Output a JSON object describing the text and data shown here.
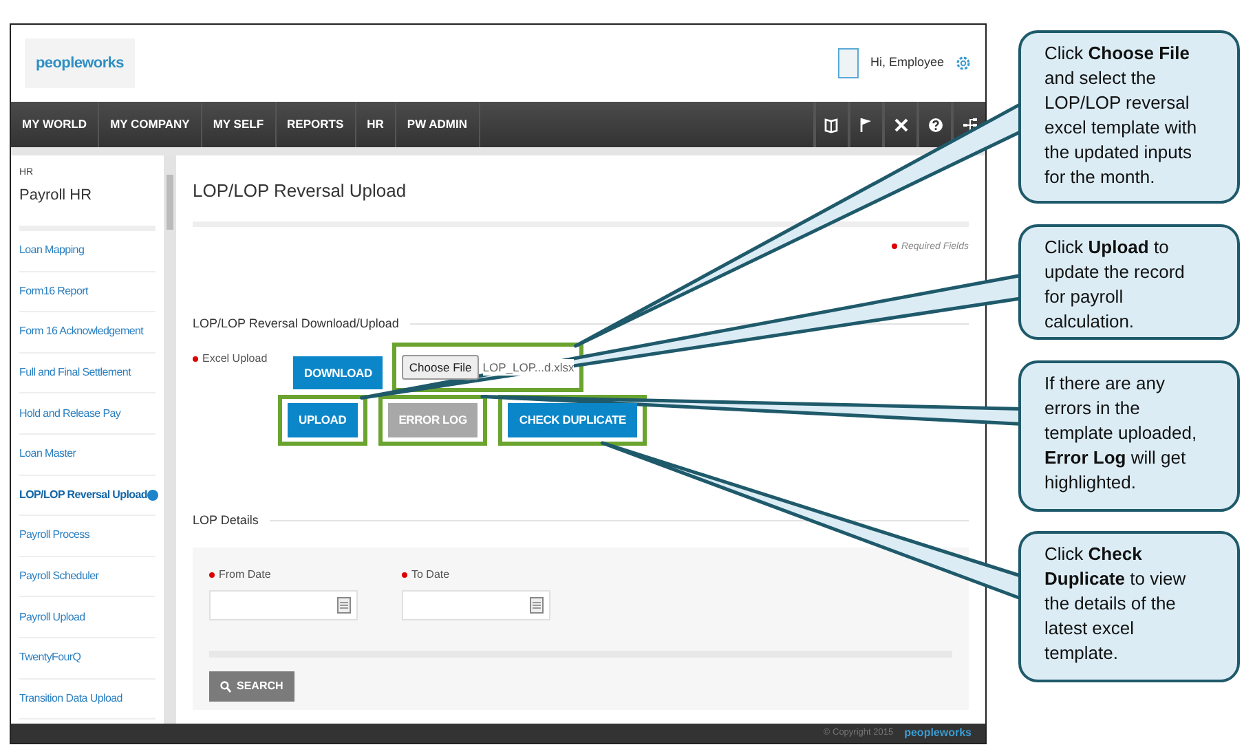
{
  "header": {
    "logo": "peopleworks",
    "greeting": "Hi, Employee"
  },
  "nav": [
    {
      "label": "MY WORLD"
    },
    {
      "label": "MY COMPANY"
    },
    {
      "label": "MY SELF"
    },
    {
      "label": "REPORTS"
    },
    {
      "label": "HR"
    },
    {
      "label": "PW ADMIN"
    }
  ],
  "sidebar": {
    "section": "HR",
    "title": "Payroll HR",
    "items": [
      {
        "label": "Loan Mapping",
        "selected": false
      },
      {
        "label": "Form16 Report",
        "selected": false
      },
      {
        "label": "Form 16 Acknowledgement",
        "selected": false
      },
      {
        "label": "Full and Final Settlement",
        "selected": false
      },
      {
        "label": "Hold and Release Pay",
        "selected": false
      },
      {
        "label": "Loan Master",
        "selected": false
      },
      {
        "label": "LOP/LOP Reversal Upload",
        "selected": true
      },
      {
        "label": "Payroll Process",
        "selected": false
      },
      {
        "label": "Payroll Scheduler",
        "selected": false
      },
      {
        "label": "Payroll Upload",
        "selected": false
      },
      {
        "label": "TwentyFourQ",
        "selected": false
      },
      {
        "label": "Transition Data Upload",
        "selected": false
      }
    ]
  },
  "page": {
    "title": "LOP/LOP Reversal Upload",
    "required_note": "Required Fields",
    "upload_section": {
      "legend": "LOP/LOP Reversal Download/Upload",
      "field_label": "Excel Upload",
      "download": {
        "label": "DOWNLOAD",
        "highlighted": false
      },
      "file": {
        "button": "Choose File",
        "filename": "LOP_LOP...d.xlsx",
        "highlighted": true
      },
      "actions": [
        {
          "label": "UPLOAD",
          "disabled": false,
          "highlighted": true
        },
        {
          "label": "ERROR LOG",
          "disabled": true,
          "highlighted": true
        },
        {
          "label": "CHECK DUPLICATE",
          "disabled": false,
          "highlighted": true
        }
      ]
    },
    "details": {
      "legend": "LOP Details",
      "fields": [
        {
          "label": "From Date"
        },
        {
          "label": "To Date"
        }
      ],
      "search_button": "SEARCH"
    }
  },
  "footer": {
    "copyright": "© Copyright 2015",
    "logo": "peopleworks"
  },
  "callouts": [
    {
      "text": "Click **Choose File** and select the LOP/LOP reversal excel template with the updated inputs for the month."
    },
    {
      "text": "Click **Upload** to update the record for payroll calculation."
    },
    {
      "text": "If there are any errors in the template uploaded, **Error Log** will get highlighted."
    },
    {
      "text": "Click **Check Duplicate** to view the details of the latest excel template."
    }
  ]
}
